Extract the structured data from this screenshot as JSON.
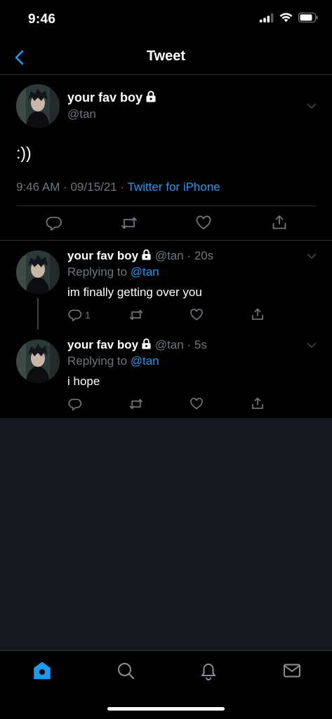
{
  "status_bar": {
    "time": "9:46"
  },
  "header": {
    "title": "Tweet"
  },
  "main_tweet": {
    "display_name": "your fav boy",
    "handle": "@tan",
    "text": ":))",
    "timestamp": "9:46 AM · 09/15/21 · ",
    "source": "Twitter for iPhone"
  },
  "replies": [
    {
      "display_name": "your fav boy",
      "handle_time": "@tan · 20s",
      "replying_prefix": "Replying to ",
      "replying_handle": "@tan",
      "text": "im finally getting over you",
      "reply_count": "1"
    },
    {
      "display_name": "your fav boy",
      "handle_time": "@tan · 5s",
      "replying_prefix": "Replying to ",
      "replying_handle": "@tan",
      "text": "i hope",
      "reply_count": ""
    }
  ],
  "tab_bar": {
    "tabs": [
      "home-icon",
      "search-icon",
      "bell-icon",
      "mail-icon"
    ],
    "active": "home-icon"
  },
  "colors": {
    "accent": "#1d9bf0",
    "secondary_text": "#71767b",
    "background": "#000000",
    "empty_area": "#15181c"
  }
}
